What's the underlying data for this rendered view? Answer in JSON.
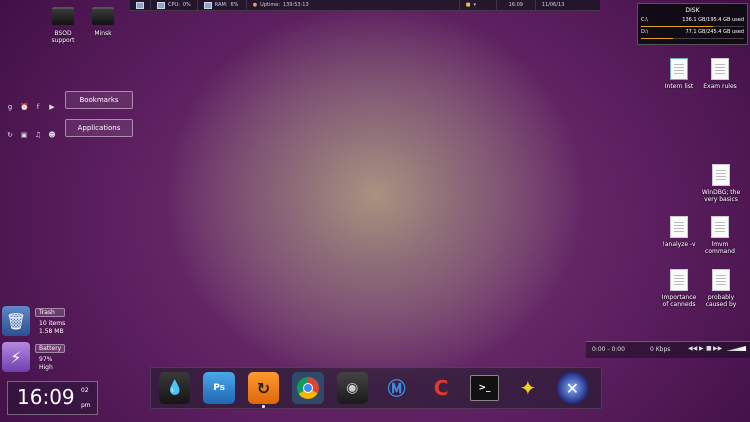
{
  "topbar": {
    "cpu_label": "CPU:",
    "cpu_value": "0%",
    "ram_label": "RAM:",
    "ram_value": "6%",
    "uptime_label": "Uptime:",
    "uptime_value": "139:53:13",
    "time": "16:09",
    "date": "11/06/13"
  },
  "desktop_left": [
    {
      "label": "BSOD support"
    },
    {
      "label": "Minsk"
    }
  ],
  "launcher": {
    "bookmarks_label": "Bookmarks",
    "applications_label": "Applications"
  },
  "disk": {
    "title": "DISK",
    "drives": [
      {
        "name": "C:\\",
        "usage": "136.1 GB/195.4 GB used",
        "fill": 0.7
      },
      {
        "name": "D:\\",
        "usage": "77.1 GB/245.4 GB used",
        "fill": 0.31
      }
    ]
  },
  "desktop_right": {
    "intern_list": "Intern list",
    "exam_rules": "Exam rules",
    "windbg": "WinDBG; the very basics",
    "analyze": "!analyze -v",
    "lmvm": "lmvm command",
    "importance": "Importance of canneds",
    "probably": "probably caused by"
  },
  "trash": {
    "title": "Trash",
    "items": "10 items",
    "size": "1.58 MB"
  },
  "battery": {
    "title": "Battery",
    "percent": "97%",
    "status": "High"
  },
  "clock": {
    "time": "16:09",
    "day": "02",
    "ampm": "pm"
  },
  "player": {
    "time": "0:00 - 0:00",
    "bitrate": "0 Kbps"
  },
  "dock": {
    "items": [
      {
        "name": "rainmeter",
        "label": "Rainmeter"
      },
      {
        "name": "photoshop",
        "label": "Ps"
      },
      {
        "name": "refresh-app",
        "label": ""
      },
      {
        "name": "chrome",
        "label": ""
      },
      {
        "name": "speaker",
        "label": ""
      },
      {
        "name": "malwarebytes",
        "label": ""
      },
      {
        "name": "ccleaner",
        "label": ""
      },
      {
        "name": "terminal",
        "label": ">_"
      },
      {
        "name": "puzzle-app",
        "label": ""
      },
      {
        "name": "compass-app",
        "label": ""
      }
    ]
  },
  "colors": {
    "accent": "#3fa7e0",
    "background": "#5a1e5e"
  }
}
